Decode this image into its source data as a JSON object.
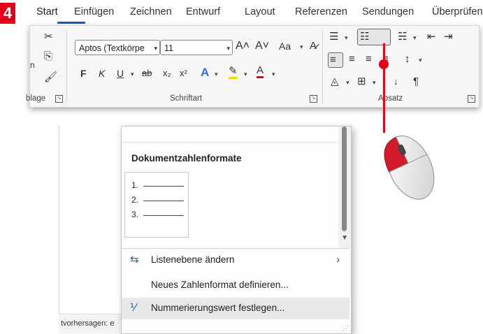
{
  "step_number": "4",
  "ribbon": {
    "tabs": [
      "Start",
      "Einfügen",
      "Zeichnen",
      "Entwurf",
      "Layout",
      "Referenzen",
      "Sendungen",
      "Überprüfen"
    ],
    "clipboard_label": "blage",
    "font_group_label": "Schriftart",
    "paragraph_group_label": "Absatz",
    "font_name": "Aptos (Textkörpe",
    "font_size": "11",
    "bold": "F",
    "italic": "K",
    "underline": "U",
    "strike": "ab",
    "subscript": "x₂",
    "superscript": "x²",
    "grow_font": "A˄",
    "shrink_font": "A˅",
    "change_case": "Aa",
    "show_marks": "¶"
  },
  "dropdown": {
    "section_title": "Dokumentzahlenformate",
    "formats": [
      "1.",
      "2.",
      "3."
    ],
    "items": [
      {
        "label": "Listenebene ändern"
      },
      {
        "label": "Neues Zahlenformat definieren..."
      },
      {
        "label": "Nummerierungswert festlegen..."
      }
    ]
  },
  "statusbar": {
    "text": "tvorhersagen: e"
  },
  "colors": {
    "accent": "#185abd",
    "badge": "#e3001b",
    "pointer": "#e3001b"
  }
}
